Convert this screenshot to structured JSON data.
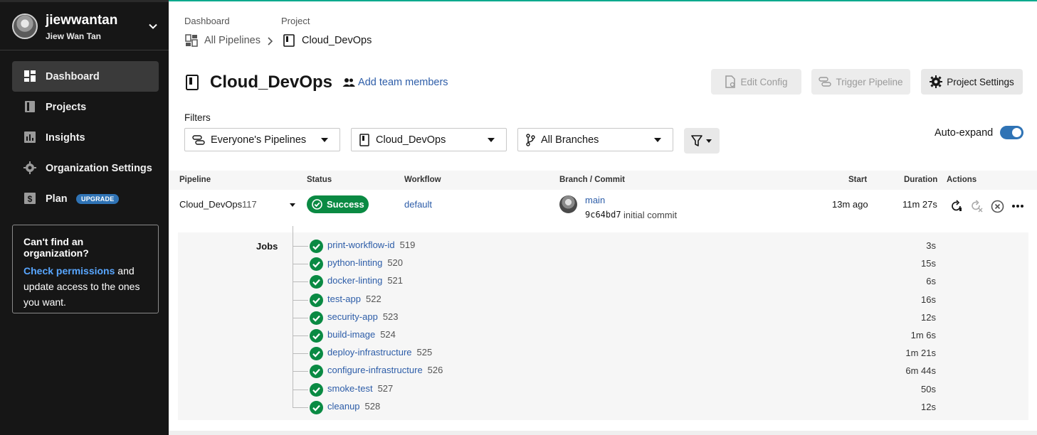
{
  "sidebar": {
    "user": {
      "handle": "jiewwantan",
      "name": "Jiew Wan Tan"
    },
    "nav": [
      {
        "label": "Dashboard",
        "icon": "dashboard-icon",
        "active": true
      },
      {
        "label": "Projects",
        "icon": "projects-icon",
        "active": false
      },
      {
        "label": "Insights",
        "icon": "insights-icon",
        "active": false
      },
      {
        "label": "Organization Settings",
        "icon": "gear-icon",
        "active": false
      },
      {
        "label": "Plan",
        "icon": "dollar-icon",
        "active": false,
        "badge": "UPGRADE"
      }
    ],
    "org_card": {
      "title": "Can't find an organization?",
      "link": "Check permissions",
      "text_after_link": " and update access to the ones you want."
    }
  },
  "breadcrumb": {
    "dashboard_label": "Dashboard",
    "dashboard_value": "All Pipelines",
    "project_label": "Project",
    "project_value": "Cloud_DevOps"
  },
  "header": {
    "title": "Cloud_DevOps",
    "add_team": "Add team members",
    "edit_config": "Edit Config",
    "trigger_pipeline": "Trigger Pipeline",
    "project_settings": "Project Settings"
  },
  "filters": {
    "label": "Filters",
    "pipelines": "Everyone's Pipelines",
    "project": "Cloud_DevOps",
    "branches": "All Branches",
    "auto_expand_label": "Auto-expand",
    "auto_expand_on": true
  },
  "table": {
    "headers": {
      "pipeline": "Pipeline",
      "status": "Status",
      "workflow": "Workflow",
      "branch_commit": "Branch / Commit",
      "start": "Start",
      "duration": "Duration",
      "actions": "Actions"
    },
    "row": {
      "pipeline": "Cloud_DevOps",
      "number": "117",
      "status": "Success",
      "workflow": "default",
      "branch": "main",
      "commit_hash": "9c64bd7",
      "commit_msg": "initial commit",
      "start": "13m ago",
      "duration": "11m 27s"
    }
  },
  "jobs": {
    "label": "Jobs",
    "items": [
      {
        "name": "print-workflow-id",
        "number": "519",
        "duration": "3s"
      },
      {
        "name": "python-linting",
        "number": "520",
        "duration": "15s"
      },
      {
        "name": "docker-linting",
        "number": "521",
        "duration": "6s"
      },
      {
        "name": "test-app",
        "number": "522",
        "duration": "16s"
      },
      {
        "name": "security-app",
        "number": "523",
        "duration": "12s"
      },
      {
        "name": "build-image",
        "number": "524",
        "duration": "1m 6s"
      },
      {
        "name": "deploy-infrastructure",
        "number": "525",
        "duration": "1m 21s"
      },
      {
        "name": "configure-infrastructure",
        "number": "526",
        "duration": "6m 44s"
      },
      {
        "name": "smoke-test",
        "number": "527",
        "duration": "50s"
      },
      {
        "name": "cleanup",
        "number": "528",
        "duration": "12s"
      }
    ]
  },
  "colors": {
    "success": "#0a8a43",
    "link": "#2d5da8",
    "sidebar": "#161616",
    "accent": "#2f73b5"
  }
}
